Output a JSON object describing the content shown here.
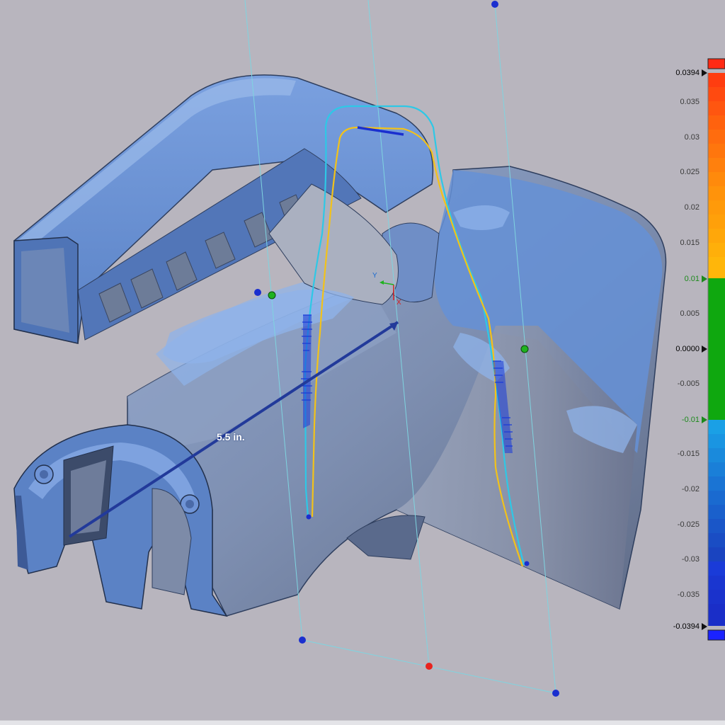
{
  "dimension": {
    "label": "5.5 in."
  },
  "legend": {
    "max_label": "0.0394",
    "min_label": "-0.0394",
    "tolerance_upper": "0.01",
    "tolerance_lower": "-0.01",
    "ticks": [
      "0.035",
      "0.03",
      "0.025",
      "0.02",
      "0.015",
      "0.005",
      "0.0000",
      "-0.005",
      "-0.015",
      "-0.02",
      "-0.025",
      "-0.03",
      "-0.035"
    ],
    "colors": {
      "over_max": "#ff2a14",
      "high": "#ff4a10",
      "mid_high": "#ff9a0a",
      "in_tolerance": "#0fa80f",
      "low": "#1aa0e6",
      "very_low": "#1a3bd8",
      "under_min": "#1a22ff"
    }
  },
  "axes_triad": {
    "y_label": "Y",
    "x_label": "X"
  },
  "colors": {
    "background": "#b8b5be",
    "part_surface": "#5d86c9",
    "part_light": "#8eb2ea",
    "section_plane": "#7fd4e0",
    "deviation_positive": "#f2c21a",
    "deviation_nominal": "#2ec8e6",
    "handle_blue": "#1a2fcf",
    "handle_green": "#1fb21f",
    "handle_red": "#e8231e"
  }
}
